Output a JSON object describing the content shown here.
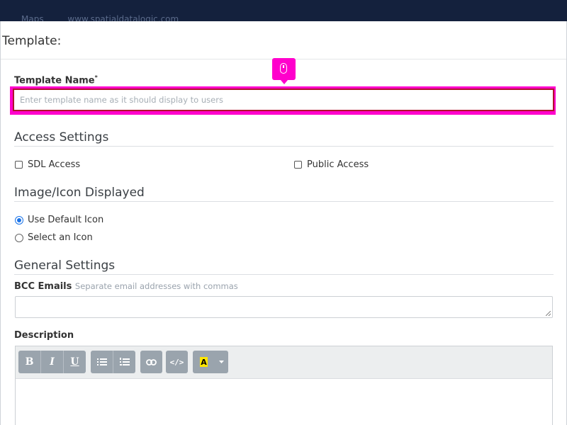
{
  "topbar": {
    "nav_maps": "Maps",
    "nav_site": "www.spatialdatalogic.com"
  },
  "modal": {
    "title": "Template:",
    "template_name": {
      "label": "Template Name",
      "required_mark": "*",
      "placeholder": "Enter template name as it should display to users",
      "value": ""
    },
    "access_settings": {
      "heading": "Access Settings",
      "sdl_access": "SDL Access",
      "public_access": "Public Access"
    },
    "image_icon": {
      "heading": "Image/Icon Displayed",
      "use_default": "Use Default Icon",
      "select_icon": "Select an Icon",
      "selected": "use_default"
    },
    "general_settings": {
      "heading": "General Settings",
      "bcc_label": "BCC Emails",
      "bcc_hint": "Separate email addresses with commas",
      "bcc_value": ""
    },
    "description": {
      "label": "Description"
    }
  },
  "editor_toolbar": {
    "bold": "B",
    "italic": "I",
    "underline": "U",
    "unordered_list": "list-ul-icon",
    "ordered_list": "list-ol-icon",
    "link": "link-icon",
    "code": "</>",
    "highlight": "A",
    "dropdown": "caret-down-icon"
  },
  "colors": {
    "highlight_pink": "#ff00cc",
    "input_border": "#b0122c",
    "radio_blue": "#1a73e8",
    "topbar": "#14213d"
  }
}
